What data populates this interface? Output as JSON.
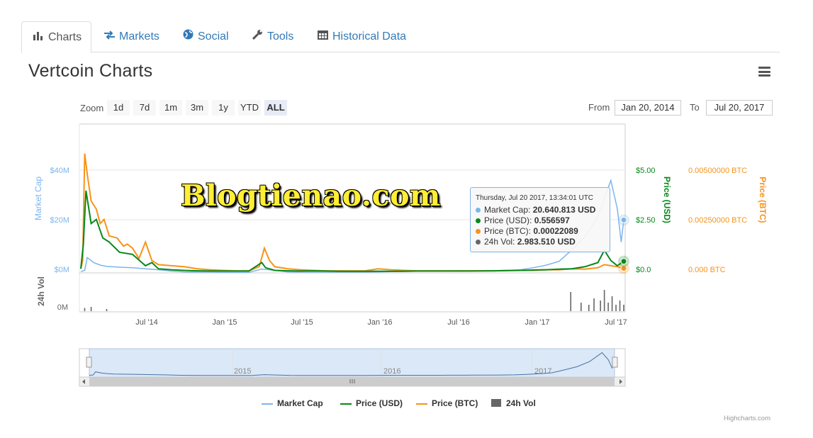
{
  "tabs": [
    {
      "label": "Charts",
      "icon": "bar-chart-icon"
    },
    {
      "label": "Markets",
      "icon": "exchange-icon"
    },
    {
      "label": "Social",
      "icon": "globe-icon"
    },
    {
      "label": "Tools",
      "icon": "wrench-icon"
    },
    {
      "label": "Historical Data",
      "icon": "calendar-icon"
    }
  ],
  "page_title": "Vertcoin Charts",
  "zoom": {
    "label": "Zoom",
    "buttons": [
      "1d",
      "7d",
      "1m",
      "3m",
      "1y",
      "YTD",
      "ALL"
    ],
    "selected": "ALL"
  },
  "range": {
    "from_label": "From",
    "from_value": "Jan 20, 2014",
    "to_label": "To",
    "to_value": "Jul 20, 2017"
  },
  "tooltip": {
    "header": "Thursday, Jul 20 2017, 13:34:01 UTC",
    "rows": [
      {
        "label": "Market Cap:",
        "value": "20.640.813 USD",
        "color": "#7cb5ec"
      },
      {
        "label": "Price (USD):",
        "value": "0.556597",
        "color": "#07881a"
      },
      {
        "label": "Price (BTC):",
        "value": "0.00022089",
        "color": "#f7931a"
      },
      {
        "label": "24h Vol:",
        "value": "2.983.510 USD",
        "color": "#666666"
      }
    ]
  },
  "watermark": "Blogtienao.com",
  "chart_data": {
    "type": "line",
    "x_ticks": [
      "Jul '14",
      "Jan '15",
      "Jul '15",
      "Jan '16",
      "Jul '16",
      "Jan '17",
      "Jul '17"
    ],
    "axes": {
      "market_cap": {
        "title": "Market Cap",
        "ticks": [
          "$0M",
          "$20M",
          "$40M"
        ],
        "range": [
          0,
          40
        ]
      },
      "price_usd": {
        "title": "Price (USD)",
        "ticks": [
          "$0.0",
          "$2.50",
          "$5.00"
        ],
        "range": [
          0,
          5
        ]
      },
      "price_btc": {
        "title": "Price (BTC)",
        "ticks": [
          "0.000 BTC",
          "0.00250000 BTC",
          "0.00500000 BTC"
        ],
        "range": [
          0,
          0.005
        ]
      },
      "volume": {
        "title": "24h Vol",
        "ticks": [
          "0M"
        ]
      }
    },
    "series": [
      {
        "name": "Market Cap",
        "color": "#7cb5ec",
        "unit": "USD M",
        "x": [
          0,
          0.3,
          0.5,
          1,
          1.5,
          2,
          3,
          4,
          5,
          6,
          7,
          8,
          9,
          10,
          11,
          12,
          13,
          14,
          15,
          16,
          17,
          18,
          19,
          20,
          21,
          22,
          23,
          24,
          25,
          26,
          27,
          28,
          29,
          30,
          31,
          32,
          33,
          34,
          35,
          36,
          37,
          38,
          39,
          40,
          41,
          41.5,
          41.8,
          42
        ],
        "y": [
          0.5,
          1,
          6,
          4,
          3,
          2.5,
          2.2,
          2,
          1.6,
          1.2,
          0.7,
          0.4,
          0.3,
          0.3,
          0.2,
          0.2,
          0.2,
          1.5,
          1,
          0.4,
          0.3,
          0.3,
          0.3,
          0.3,
          0.3,
          0.3,
          0.4,
          0.5,
          0.5,
          0.6,
          0.6,
          0.6,
          0.7,
          0.7,
          0.8,
          0.8,
          1,
          1.2,
          2,
          3,
          4.5,
          9,
          14,
          22,
          36,
          25,
          12,
          20.6
        ]
      },
      {
        "name": "Price (USD)",
        "color": "#07881a",
        "unit": "USD",
        "x": [
          0,
          0.2,
          0.4,
          0.8,
          1.2,
          1.7,
          2.2,
          3,
          4,
          5,
          5.5,
          6,
          7,
          8,
          9,
          10,
          11,
          12,
          13,
          14,
          14.3,
          15,
          16,
          17,
          18,
          19,
          20,
          22,
          24,
          26,
          28,
          30,
          32,
          34,
          36,
          37,
          38,
          39,
          40,
          40.5,
          41,
          41.5,
          42
        ],
        "y": [
          0.2,
          1.4,
          4.0,
          2.4,
          2.6,
          1.7,
          1.5,
          1.0,
          0.9,
          0.35,
          0.5,
          0.2,
          0.15,
          0.12,
          0.1,
          0.09,
          0.09,
          0.09,
          0.09,
          0.5,
          0.25,
          0.12,
          0.1,
          0.09,
          0.1,
          0.09,
          0.08,
          0.08,
          0.08,
          0.09,
          0.09,
          0.09,
          0.1,
          0.12,
          0.15,
          0.18,
          0.2,
          0.3,
          0.5,
          1.1,
          0.6,
          0.35,
          0.56
        ]
      },
      {
        "name": "Price (BTC)",
        "color": "#f7931a",
        "unit": "BTC",
        "x": [
          0,
          0.15,
          0.3,
          0.5,
          0.8,
          1.2,
          1.5,
          1.8,
          2.2,
          2.8,
          3.3,
          3.6,
          4,
          4.5,
          5,
          5.5,
          6,
          7,
          8,
          9,
          10,
          11,
          12,
          13,
          13.8,
          14.2,
          14.6,
          15,
          16,
          17,
          18,
          19,
          20,
          21,
          22,
          23,
          24,
          25,
          26,
          27,
          28,
          29,
          30,
          31,
          32,
          33,
          34,
          35,
          36,
          37,
          38,
          39,
          40,
          40.5,
          41,
          41.5,
          42
        ],
        "y": [
          0.0002,
          0.0006,
          0.0058,
          0.0048,
          0.0035,
          0.0031,
          0.0024,
          0.0026,
          0.0018,
          0.0017,
          0.0013,
          0.0014,
          0.0012,
          0.0007,
          0.0015,
          0.0006,
          0.0004,
          0.00035,
          0.0003,
          0.0002,
          0.00015,
          0.00012,
          0.0001,
          0.0001,
          0.0003,
          0.0012,
          0.0006,
          0.0003,
          0.0002,
          0.00015,
          0.00012,
          0.0001,
          0.0001,
          0.0001,
          0.0001,
          0.0002,
          0.00015,
          0.00012,
          0.0001,
          0.0001,
          0.0001,
          0.0001,
          0.0001,
          0.0001,
          0.0001,
          0.00012,
          0.00012,
          0.00012,
          0.00015,
          0.00015,
          0.0002,
          0.00018,
          0.00025,
          0.0004,
          0.00035,
          0.0003,
          0.00022
        ]
      },
      {
        "name": "24h Vol",
        "color": "#666666",
        "unit": "USD",
        "x": [
          0.3,
          0.8,
          2,
          37.9,
          38.7,
          39.3,
          39.7,
          40.2,
          40.5,
          40.8,
          41.1,
          41.4,
          41.7,
          42
        ],
        "y": [
          0.15,
          0.2,
          0.1,
          0.9,
          0.4,
          0.3,
          0.6,
          0.5,
          1.0,
          0.4,
          0.7,
          0.3,
          0.5,
          0.3
        ]
      }
    ],
    "navigator": {
      "ticks": [
        "2015",
        "2016",
        "2017"
      ]
    },
    "legend": [
      "Market Cap",
      "Price (USD)",
      "Price (BTC)",
      "24h Vol"
    ],
    "legend_position": "bottom-center"
  },
  "credits": "Highcharts.com"
}
